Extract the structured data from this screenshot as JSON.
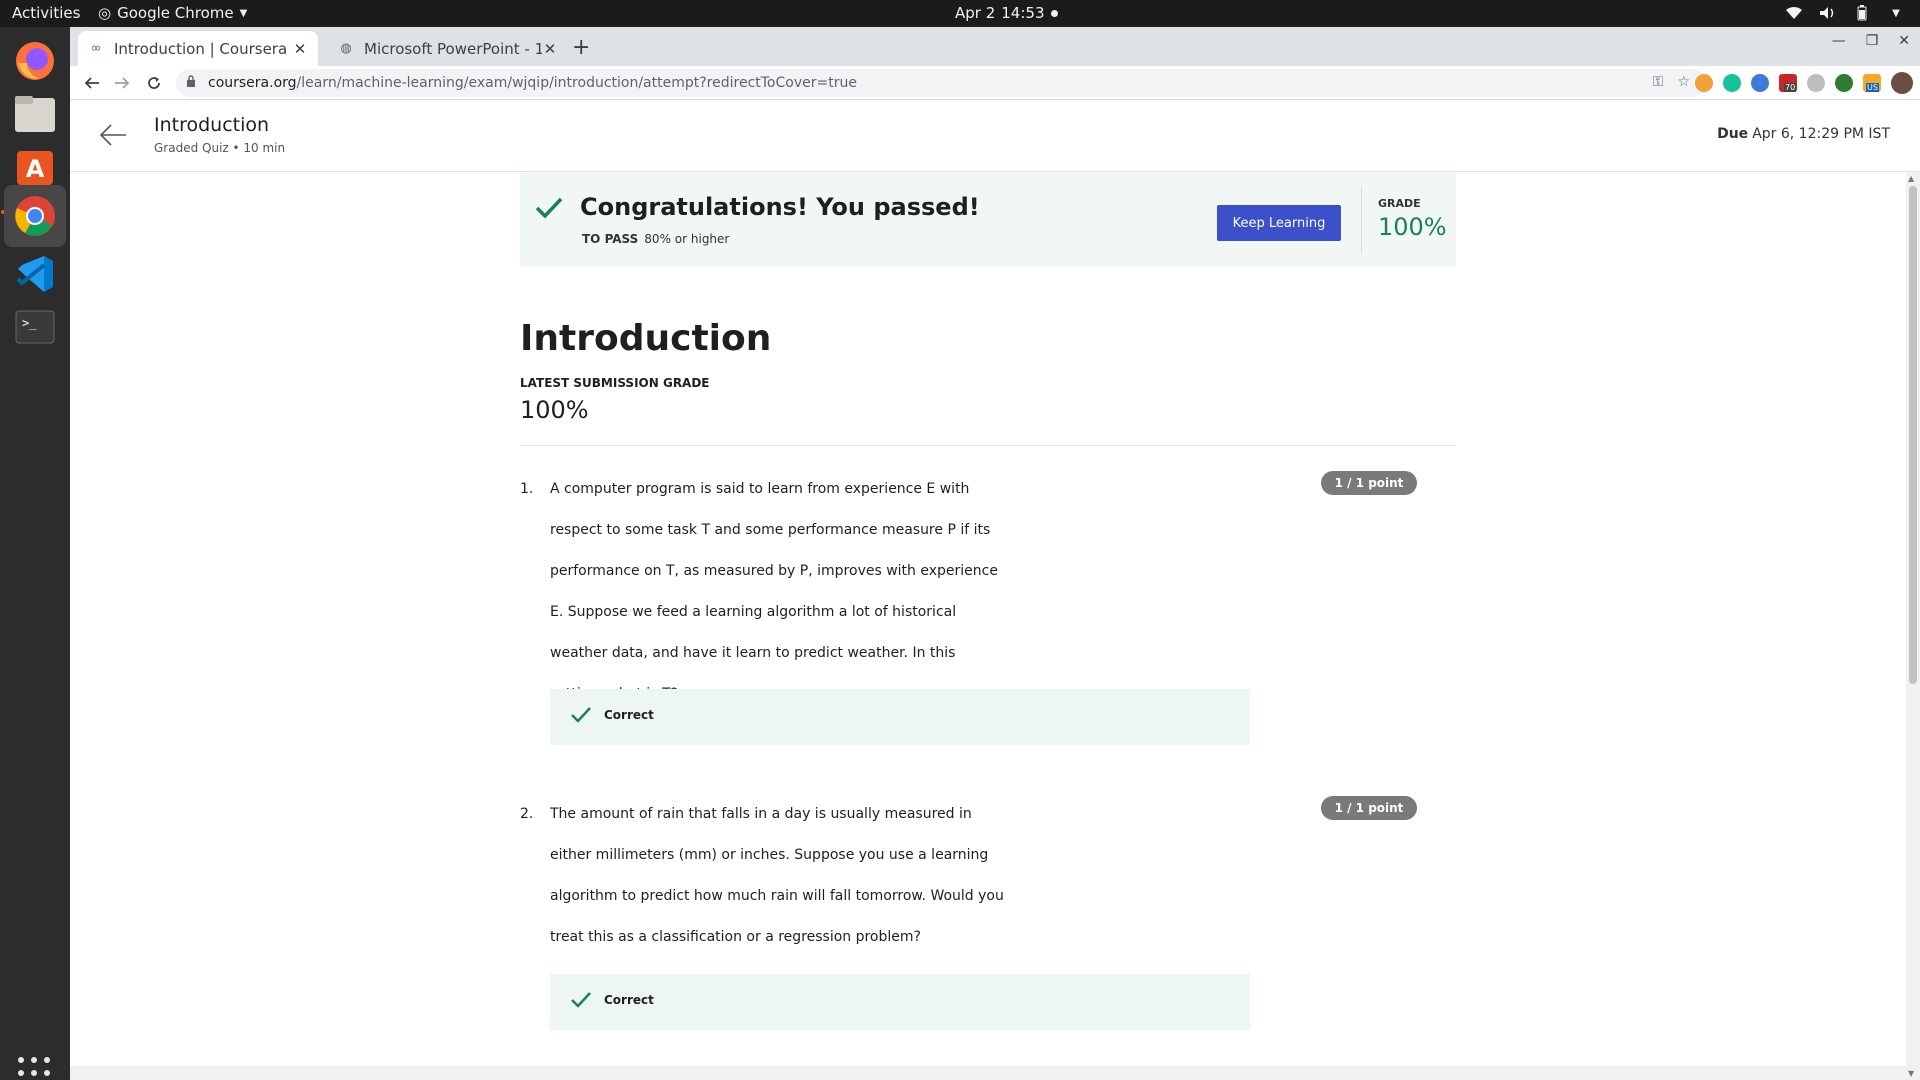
{
  "system": {
    "activities": "Activities",
    "app_name": "Google Chrome",
    "date": "Apr 2",
    "time": "14:53"
  },
  "browser": {
    "tabs": [
      {
        "title": "Introduction | Coursera",
        "active": true
      },
      {
        "title": "Microsoft PowerPoint - 1...",
        "active": false
      }
    ],
    "url_host": "coursera.org",
    "url_path": "/learn/machine-learning/exam/wjqip/introduction/attempt?redirectToCover=true",
    "ext_badges": [
      "70",
      "US"
    ]
  },
  "header": {
    "title": "Introduction",
    "subtitle": "Graded Quiz • 10 min",
    "due_label": "Due",
    "due_value": "Apr 6, 12:29 PM IST"
  },
  "banner": {
    "headline": "Congratulations! You passed!",
    "to_pass_label": "TO PASS",
    "to_pass_value": "80% or higher",
    "button": "Keep Learning",
    "grade_label": "GRADE",
    "grade_value": "100%"
  },
  "quiz": {
    "title": "Introduction",
    "latest_label": "LATEST SUBMISSION GRADE",
    "latest_value": "100%",
    "questions": [
      {
        "number": "1.",
        "text": "A computer program is said to learn from experience E with respect to some task T and some performance measure P if its performance on T, as measured by P, improves with experience E. Suppose we feed a learning algorithm a lot of historical weather data, and have it learn to predict weather. In this setting, what is T?",
        "points": "1 / 1 point",
        "result": "Correct"
      },
      {
        "number": "2.",
        "text": "The amount of rain that falls in a day is usually measured in either millimeters (mm) or inches. Suppose you use a learning algorithm to predict how much rain will fall tomorrow. Would you treat this as a classification or a regression problem?",
        "points": "1 / 1 point",
        "result": "Correct"
      }
    ]
  },
  "colors": {
    "accent_button": "#3b50c9",
    "success_green": "#1b7f5e",
    "banner_bg": "#f0f7f4"
  }
}
